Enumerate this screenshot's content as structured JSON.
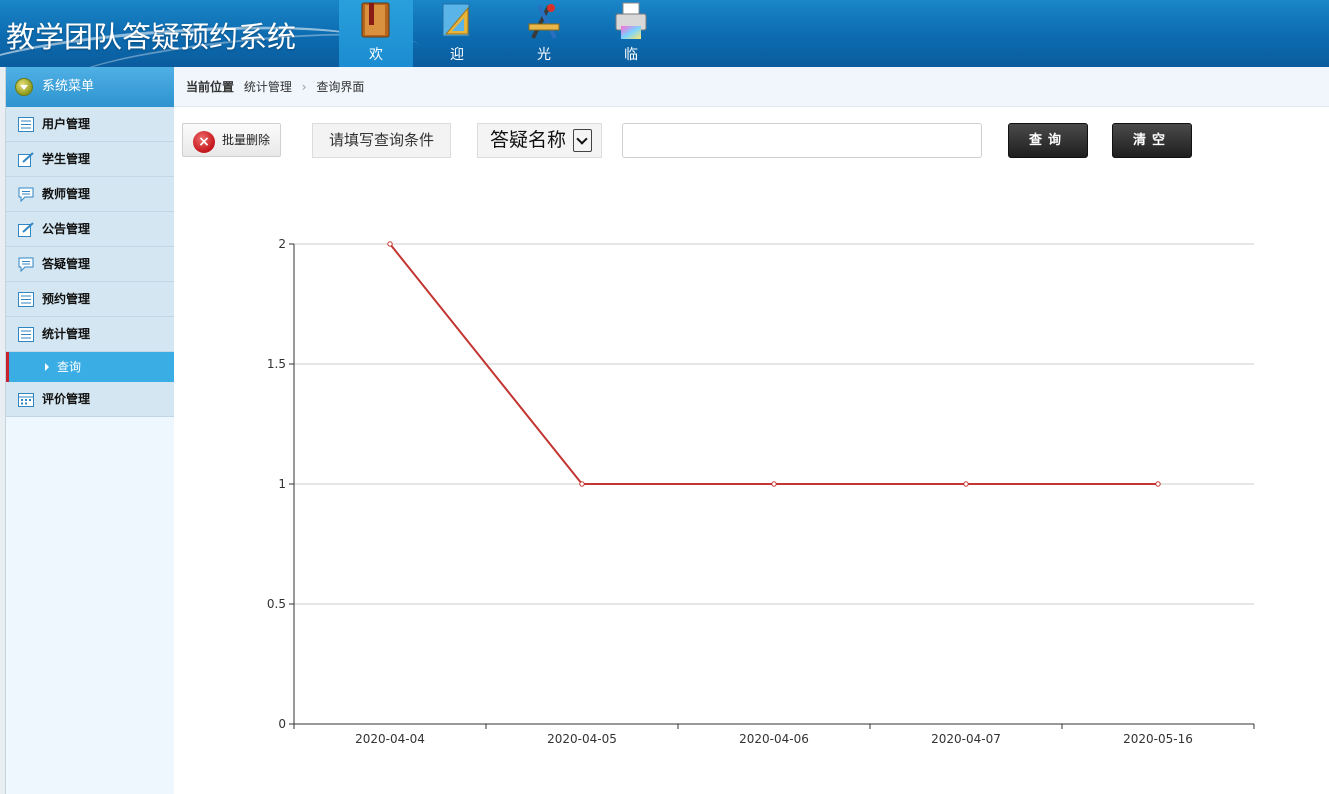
{
  "header": {
    "title": "教学团队答疑预约系统",
    "nav": [
      {
        "label": "欢",
        "icon": "book-icon",
        "active": true
      },
      {
        "label": "迎",
        "icon": "ruler-icon",
        "active": false
      },
      {
        "label": "光",
        "icon": "tools-icon",
        "active": false
      },
      {
        "label": "临",
        "icon": "printer-icon",
        "active": false
      }
    ]
  },
  "sidebar": {
    "header": "系统菜单",
    "items": [
      {
        "label": "用户管理",
        "icon": "list-icon"
      },
      {
        "label": "学生管理",
        "icon": "edit-icon"
      },
      {
        "label": "教师管理",
        "icon": "comment-icon"
      },
      {
        "label": "公告管理",
        "icon": "edit-icon"
      },
      {
        "label": "答疑管理",
        "icon": "comment-icon"
      },
      {
        "label": "预约管理",
        "icon": "list-icon"
      },
      {
        "label": "统计管理",
        "icon": "list-icon"
      }
    ],
    "sub_item": {
      "label": "查询"
    },
    "last_item": {
      "label": "评价管理",
      "icon": "calendar-icon"
    }
  },
  "breadcrumb": {
    "lead": "当前位置",
    "items": [
      "统计管理",
      "查询界面"
    ]
  },
  "toolbar": {
    "batch_delete": "批量删除",
    "condition_label": "请填写查询条件",
    "select_value": "答疑名称",
    "search_value": "",
    "query_button": "查询",
    "clear_button": "清空"
  },
  "colors": {
    "header_bg": "#0d6bb0",
    "sidebar_active": "#3aaee4",
    "line": "#c23531"
  },
  "chart_data": {
    "type": "line",
    "categories": [
      "2020-04-04",
      "2020-04-05",
      "2020-04-06",
      "2020-04-07",
      "2020-05-16"
    ],
    "series": [
      {
        "values": [
          2,
          1,
          1,
          1,
          1
        ]
      }
    ],
    "y_ticks": [
      "0",
      "0.5",
      "1",
      "1.5",
      "2"
    ],
    "ylim": [
      0,
      2
    ],
    "grid": true,
    "title": "",
    "xlabel": "",
    "ylabel": ""
  }
}
